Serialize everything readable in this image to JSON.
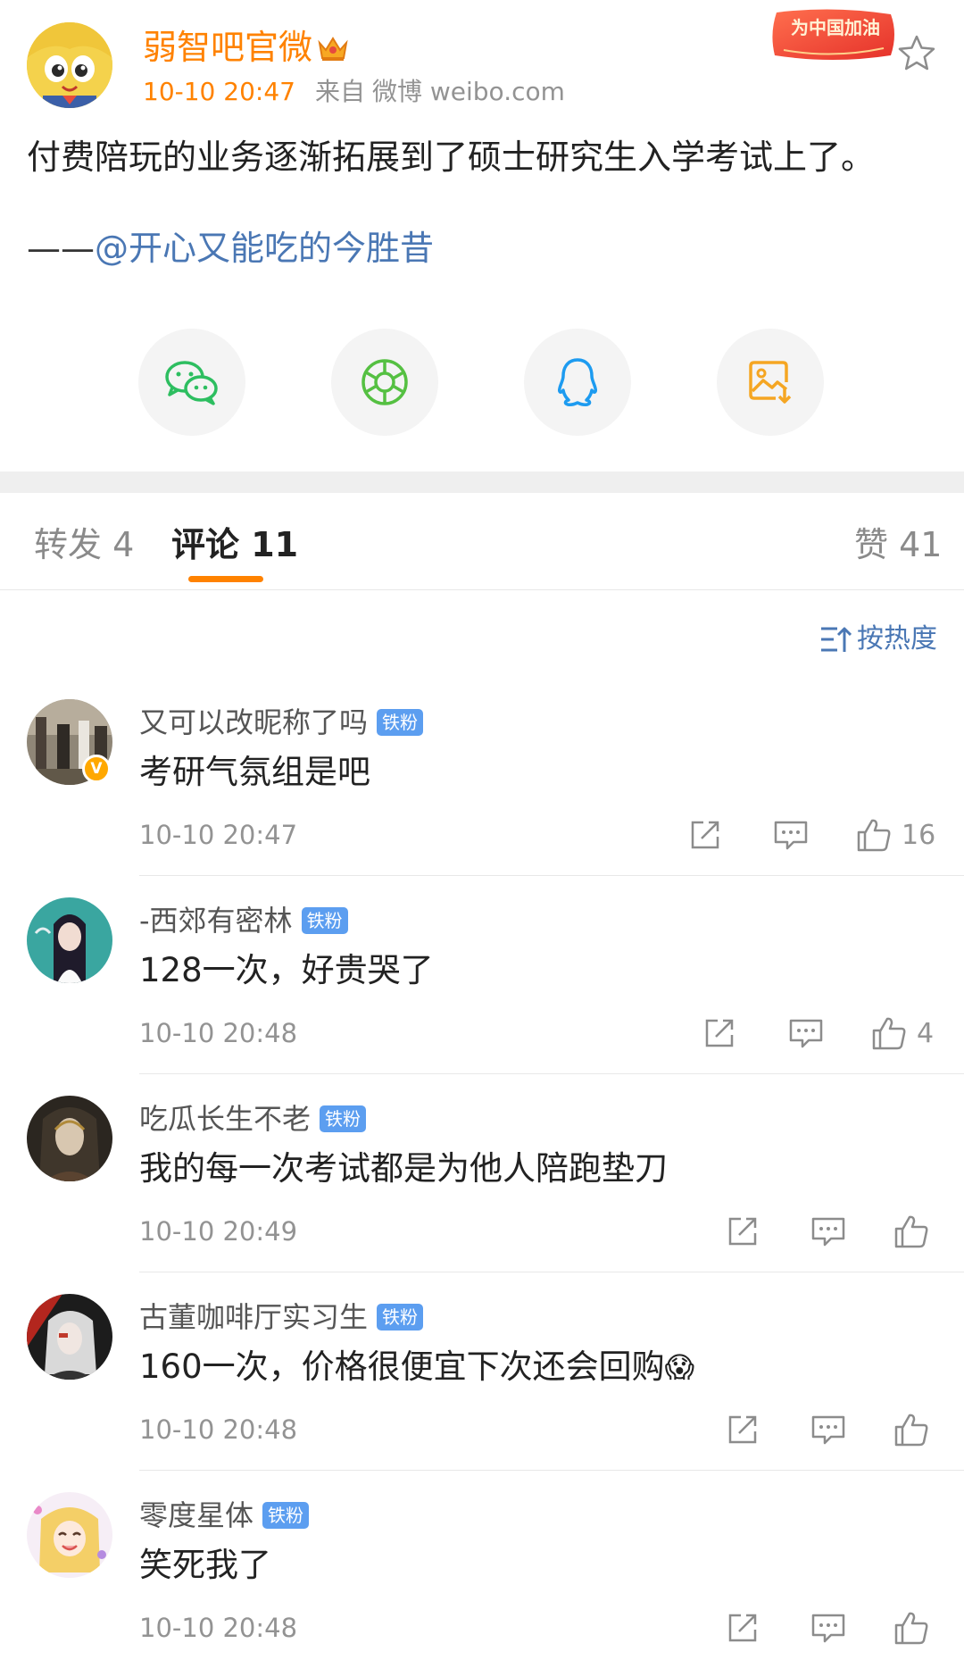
{
  "post": {
    "author_name": "弱智吧官微",
    "time": "10-10 20:47",
    "source_label": "来自",
    "source": "微博 weibo.com",
    "badge_text": "为中国加油",
    "text": "付费陪玩的业务逐渐拓展到了硕士研究生入学考试上了。",
    "credit_prefix": "——",
    "credit_mention": "@开心又能吃的今胜昔"
  },
  "share_icons": [
    "wechat-icon",
    "moments-icon",
    "qq-icon",
    "save-image-icon"
  ],
  "tabs": [
    {
      "label": "转发 4"
    },
    {
      "label": "评论 11"
    },
    {
      "label": "赞 41"
    }
  ],
  "sort_label": "按热度",
  "fan_badge": "铁粉",
  "comments": [
    {
      "name": "又可以改昵称了吗",
      "text": "考研气氛组是吧",
      "time": "10-10 20:47",
      "likes": "16",
      "verified": "V"
    },
    {
      "name": "-西郊有密林",
      "text": "128一次，好贵哭了",
      "time": "10-10 20:48",
      "likes": "4"
    },
    {
      "name": "吃瓜长生不老",
      "text": "我的每一次考试都是为他人陪跑垫刀",
      "time": "10-10 20:49",
      "likes": ""
    },
    {
      "name": "古董咖啡厅实习生",
      "text": "160一次，价格很便宜下次还会回购",
      "emoji": "😱",
      "time": "10-10 20:48",
      "likes": ""
    },
    {
      "name": "零度星体",
      "text": "笑死我了",
      "time": "10-10 20:48",
      "likes": ""
    }
  ],
  "colors": {
    "accent": "#ff8200",
    "link": "#4a77b4",
    "fan_badge": "#5c9ef0"
  }
}
